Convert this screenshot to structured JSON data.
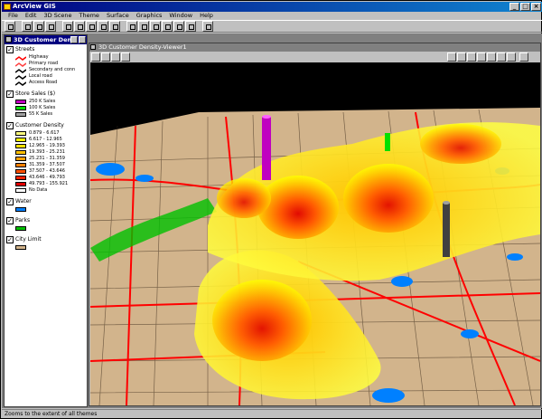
{
  "app": {
    "title": "ArcView GIS"
  },
  "menu": [
    "File",
    "Edit",
    "3D Scene",
    "Theme",
    "Surface",
    "Graphics",
    "Window",
    "Help"
  ],
  "toc_window": {
    "title": "3D Customer Den..."
  },
  "view_window": {
    "title": "3D Customer Density-Viewer1"
  },
  "themes": [
    {
      "name": "Streets",
      "checked": true,
      "legend": [
        {
          "label": "Highway",
          "kind": "line",
          "color": "#ff0000"
        },
        {
          "label": "Primary road",
          "kind": "line",
          "color": "#ff4040"
        },
        {
          "label": "Secondary and conn",
          "kind": "line",
          "color": "#000000"
        },
        {
          "label": "Local road",
          "kind": "line",
          "color": "#000000"
        },
        {
          "label": "Access Road",
          "kind": "line",
          "color": "#000000"
        }
      ]
    },
    {
      "name": "Store Sales ($)",
      "checked": true,
      "legend": [
        {
          "label": "250 K Sales",
          "kind": "fill",
          "color": "#c000c0"
        },
        {
          "label": "100 K Sales",
          "kind": "fill",
          "color": "#00e000"
        },
        {
          "label": "55 K Sales",
          "kind": "fill",
          "color": "#a0a0a0"
        }
      ]
    },
    {
      "name": "Customer Density",
      "checked": true,
      "legend": [
        {
          "label": "0.879 - 6.617",
          "kind": "fill",
          "color": "#ffff80"
        },
        {
          "label": "6.617 - 12.965",
          "kind": "fill",
          "color": "#ffff00"
        },
        {
          "label": "12.965 - 19.393",
          "kind": "fill",
          "color": "#ffe000"
        },
        {
          "label": "19.393 - 25.231",
          "kind": "fill",
          "color": "#ffc000"
        },
        {
          "label": "25.231 - 31.359",
          "kind": "fill",
          "color": "#ffa000"
        },
        {
          "label": "31.359 - 37.507",
          "kind": "fill",
          "color": "#ff8000"
        },
        {
          "label": "37.507 - 43.646",
          "kind": "fill",
          "color": "#ff5000"
        },
        {
          "label": "43.646 - 49.793",
          "kind": "fill",
          "color": "#ff2000"
        },
        {
          "label": "49.793 - 155.921",
          "kind": "fill",
          "color": "#e00000"
        },
        {
          "label": "No Data",
          "kind": "fill",
          "color": "#ffffff"
        }
      ]
    },
    {
      "name": "Water",
      "checked": true,
      "legend": [
        {
          "label": "",
          "kind": "fill",
          "color": "#0080ff"
        }
      ]
    },
    {
      "name": "Parks",
      "checked": true,
      "legend": [
        {
          "label": "",
          "kind": "fill",
          "color": "#00c000"
        }
      ]
    },
    {
      "name": "City Limit",
      "checked": true,
      "legend": [
        {
          "label": "",
          "kind": "fill",
          "color": "#d2b48c"
        }
      ]
    }
  ],
  "status": {
    "text": "Zooms to the extent of all themes"
  }
}
